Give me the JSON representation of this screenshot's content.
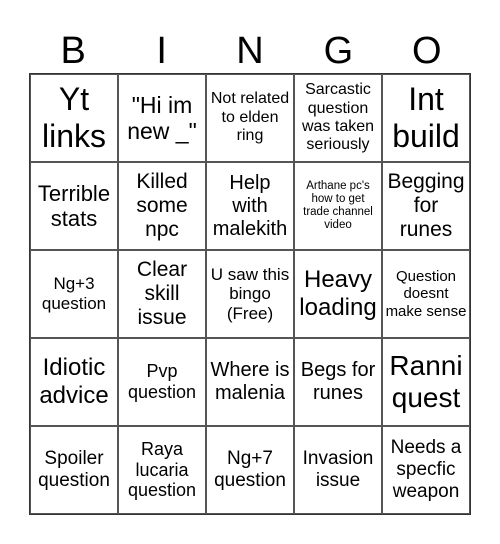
{
  "header": [
    "B",
    "I",
    "N",
    "G",
    "O"
  ],
  "cells": [
    "Yt links",
    "\"Hi im new _\"",
    "Not related to elden ring",
    "Sarcastic question was taken seriously",
    "Int build",
    "Terrible stats",
    "Killed some npc",
    "Help with malekith",
    "Arthane pc's how to get trade channel video",
    "Begging for runes",
    "Ng+3 question",
    "Clear skill issue",
    "U saw this bingo (Free)",
    "Heavy loading",
    "Question doesnt make sense",
    "Idiotic advice",
    "Pvp question",
    "Where is malenia",
    "Begs for runes",
    "Ranni quest",
    "Spoiler question",
    "Raya lucaria question",
    "Ng+7 question",
    "Invasion issue",
    "Needs a specfic weapon"
  ]
}
